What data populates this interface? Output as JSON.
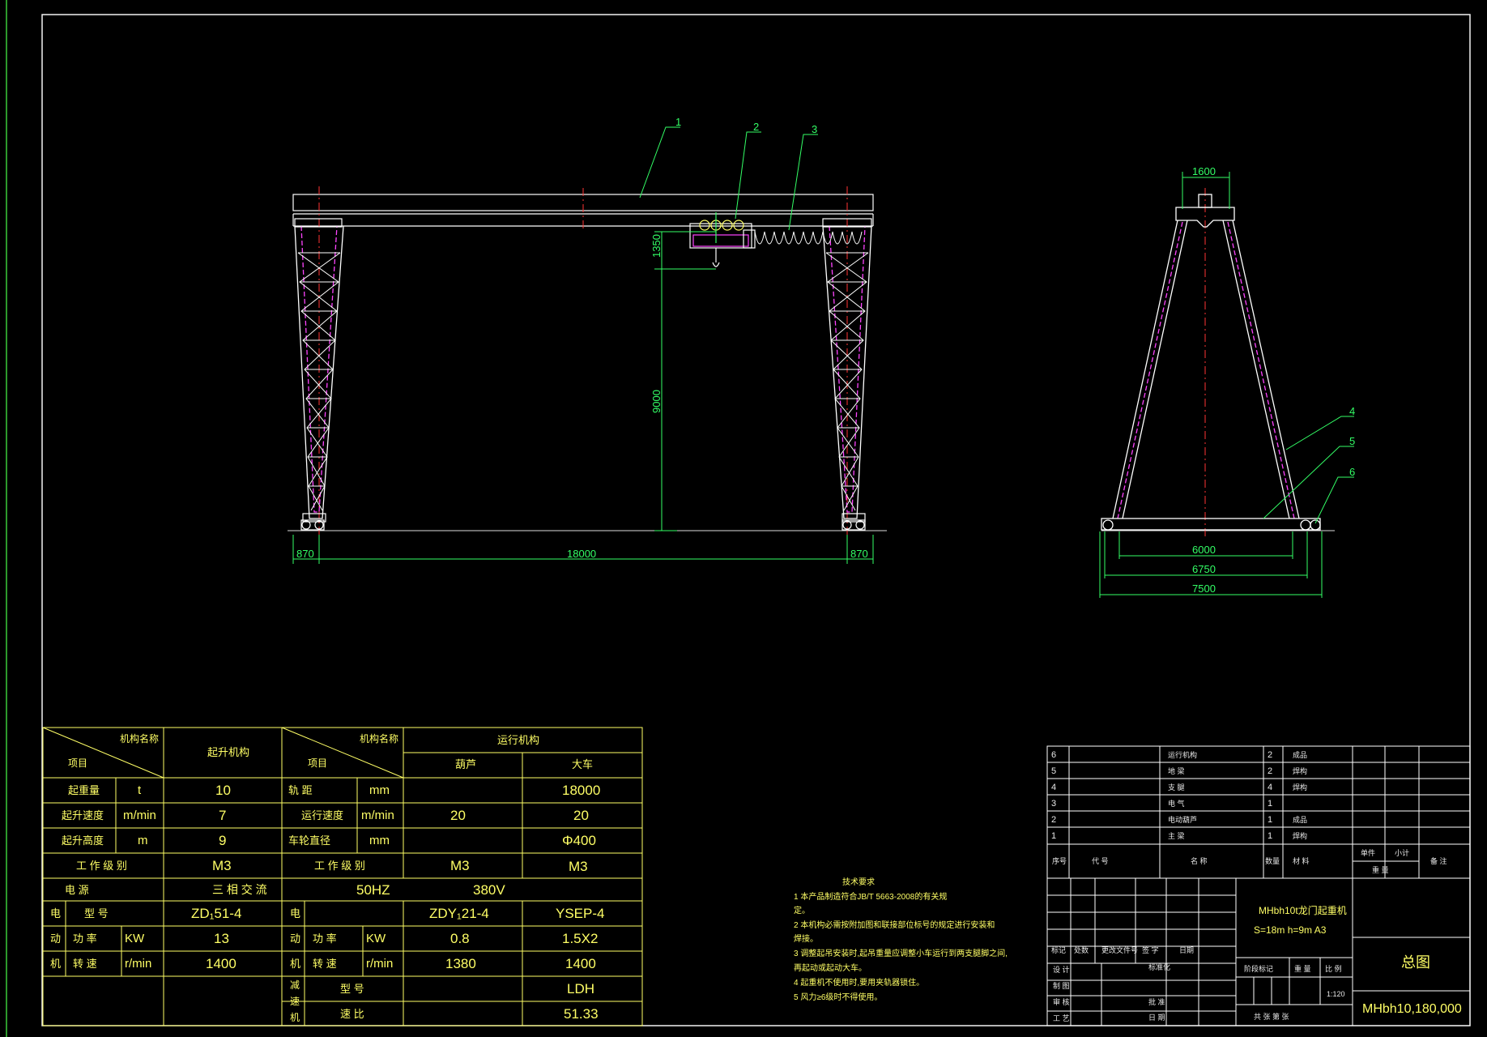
{
  "colors": {
    "background": "#000000",
    "frame": "#f2f2f2",
    "dimension": "#33ff66",
    "table": "#ffff66",
    "structure_white": "#ffffff",
    "structure_magenta": "#ff44ff",
    "centerline": "#ff3333"
  },
  "drawing": {
    "front_view": {
      "balloons": [
        "1",
        "2",
        "3"
      ],
      "dims": {
        "left_overhang": "870",
        "span": "18000",
        "right_overhang": "870",
        "lift_height": "9000",
        "hook_offset": "1350"
      }
    },
    "side_view": {
      "balloons": [
        "4",
        "5",
        "6"
      ],
      "dims": {
        "top_width": "1600",
        "rail_gauge": "6000",
        "mid_base": "6750",
        "total_base": "7500"
      }
    }
  },
  "params": {
    "header": {
      "mech_name": "机构名称",
      "item": "项目",
      "lift_mech": "起升机构",
      "travel_mech": "运行机构",
      "hoist": "葫芦",
      "crane": "大车"
    },
    "left_rows": [
      {
        "name": "起重量",
        "unit": "t",
        "value": "10"
      },
      {
        "name": "起升速度",
        "unit": "m/min",
        "value": "7"
      },
      {
        "name": "起升高度",
        "unit": "m",
        "value": "9"
      }
    ],
    "work_class_label": "工 作 级 别",
    "work_class_value": "M3",
    "right_rows": [
      {
        "name": "轨   距",
        "unit": "mm",
        "hoist": "",
        "crane": "18000"
      },
      {
        "name": "运行速度",
        "unit": "m/min",
        "hoist": "20",
        "crane": "20"
      },
      {
        "name": "车轮直径",
        "unit": "mm",
        "hoist": "",
        "crane": "Φ400"
      },
      {
        "name": "工 作 级 别",
        "unit": "",
        "hoist": "M3",
        "crane": "M3"
      }
    ],
    "power": {
      "label": "电          源",
      "phase": "三  相  交  流",
      "freq": "50HZ",
      "volt": "380V"
    },
    "motor": {
      "side_chars": [
        "电",
        "动",
        "机"
      ],
      "type_label": "型       号",
      "power_label": "功    率",
      "power_unit": "KW",
      "speed_label": "转    速",
      "speed_unit": "r/min",
      "lift_type": "ZD₁51-4",
      "lift_power": "13",
      "lift_speed": "1400",
      "hoist_type": "ZDY₁21-4",
      "hoist_power": "0.8",
      "hoist_speed": "1380",
      "crane_type": "YSEP-4",
      "crane_power": "1.5X2",
      "crane_speed": "1400"
    },
    "reducer": {
      "side_chars": [
        "减",
        "速",
        "机"
      ],
      "type_label": "型       号",
      "ratio_label": "速    比",
      "type": "LDH",
      "ratio": "51.33"
    }
  },
  "notes": {
    "title": "技术要求",
    "items": [
      "1  本产品制造符合JB/T 5663-2008的有关规",
      "定。",
      "2  本机构必需按附加图和联接部位标号的规定进行安装和",
      "焊接。",
      "3  调整起吊安装时,起吊重量应调整小车运行到两支腿脚之间,",
      "再起动或起动大车。",
      "4  起重机不使用时,要用夹轨器锁住。",
      "5  风力≥6级时不得使用。"
    ]
  },
  "bom": {
    "rows": [
      {
        "no": "6",
        "name": "运行机构",
        "qty": "2",
        "mat": "成品"
      },
      {
        "no": "5",
        "name": "地  梁",
        "qty": "2",
        "mat": "焊构"
      },
      {
        "no": "4",
        "name": "支  腿",
        "qty": "4",
        "mat": "焊构"
      },
      {
        "no": "3",
        "name": "电  气",
        "qty": "1",
        "mat": ""
      },
      {
        "no": "2",
        "name": "电动葫芦",
        "qty": "1",
        "mat": "成品"
      },
      {
        "no": "1",
        "name": "主  梁",
        "qty": "1",
        "mat": "焊构"
      }
    ],
    "headers": {
      "no": "序号",
      "code": "代          号",
      "name": "名          称",
      "qty": "数量",
      "mat": "材          料",
      "unit_w": "单件",
      "total_w": "小计",
      "weight": "重      量",
      "remark": "备  注"
    }
  },
  "title_block": {
    "product": "MHbh10t龙门起重机",
    "spec": "S=18m  h=9m  A3",
    "drawing_title": "总图",
    "drawing_no": "MHbh10,180,000",
    "labels": {
      "mark": "标记",
      "zone": "处数",
      "doc": "更改文件号",
      "sign": "签  字",
      "date": "日期",
      "design": "设 计",
      "draw": "制 图",
      "check": "审 核",
      "process": "工 艺",
      "std": "标准化",
      "audit": "批  准",
      "date2": "日  期",
      "stage": "阶段标记",
      "weight": "重  量",
      "scale": "比  例",
      "sheets": "共          张   第          张"
    },
    "scale": "1:120"
  }
}
